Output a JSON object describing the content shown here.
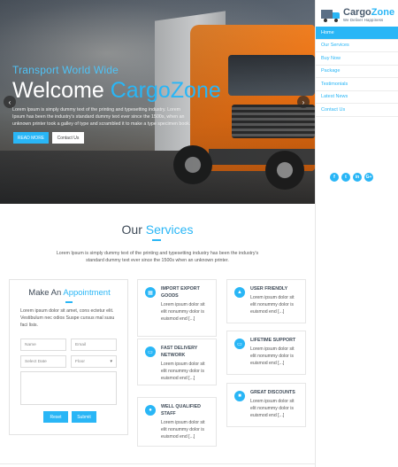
{
  "hero": {
    "subtitle": "Transport World Wide",
    "title_prefix": "Welcome ",
    "title_brand": "CargoZone",
    "description": "Lorem Ipsum is simply dummy text of the printing and typesetting industry. Lorem Ipsum has been the industry's standard dummy text ever since the 1500s, when an unknown printer took a galley of type and scrambled it to make a type specimen book.",
    "read_more": "READ MORE",
    "contact_us": "Contact Us",
    "prev_arrow": "‹",
    "next_arrow": "›"
  },
  "brand": {
    "name_part1": "Cargo",
    "name_part2": "Zone",
    "tagline": "We Deliver Happiness",
    "accent_color": "#29b6f6"
  },
  "nav": {
    "items": [
      {
        "label": "Home",
        "active": true
      },
      {
        "label": "Our Services",
        "active": false
      },
      {
        "label": "Buy Now",
        "active": false
      },
      {
        "label": "Package",
        "active": false
      },
      {
        "label": "Testimonials",
        "active": false
      },
      {
        "label": "Latest News",
        "active": false
      },
      {
        "label": "Contact Us",
        "active": false
      }
    ]
  },
  "social": {
    "facebook": "f",
    "twitter": "t",
    "linkedin": "in",
    "google": "G+"
  },
  "services": {
    "title_prefix": "Our ",
    "title_accent": "Services",
    "description": "Lorem Ipsum is simply dummy text of the printing and typesetting industry has been the industry's standard dummy text ever since the 1500s when an unknown printer."
  },
  "appointment": {
    "title_prefix": "Make An ",
    "title_accent": "Appointment",
    "description": "Lorem ipsum dolor sit amet, cons ectetur elit. Vestibulum nec odios Suspe cursus mal susu faci lisis.",
    "name_placeholder": "Name",
    "email_placeholder": "Email",
    "date_placeholder": "Select Date",
    "floor_placeholder": "Floor",
    "reset": "Reset",
    "submit": "Submit"
  },
  "features": [
    {
      "icon": "grid-icon",
      "glyph": "▦",
      "title": "IMPORT EXPORT GOODS",
      "text": "Lorem ipsum dolor sit elit nonummy dolor is euismod end [...]"
    },
    {
      "icon": "laptop-icon",
      "glyph": "▭",
      "title": "FAST DELIVERY NETWORK",
      "text": "Lorem ipsum dolor sit elit nonummy dolor is euismod end [...]"
    },
    {
      "icon": "location-icon",
      "glyph": "●",
      "title": "WELL QUALIFIED STAFF",
      "text": "Lorem ipsum dolor sit elit nonummy dolor is euismod end [...]"
    },
    {
      "icon": "user-icon",
      "glyph": "▲",
      "title": "USER FRIENDLY",
      "text": "Lorem ipsum dolor sit elit nonummy dolor is euismod end [...]"
    },
    {
      "icon": "monitor-icon",
      "glyph": "▭",
      "title": "LIFETIME SUPPORT",
      "text": "Lorem ipsum dolor sit elit nonummy dolor is euismod end [...]"
    },
    {
      "icon": "gift-icon",
      "glyph": "■",
      "title": "GREAT DISCOUNTS",
      "text": "Lorem ipsum dolor sit elit nonummy dolor is euismod end [...]"
    }
  ]
}
